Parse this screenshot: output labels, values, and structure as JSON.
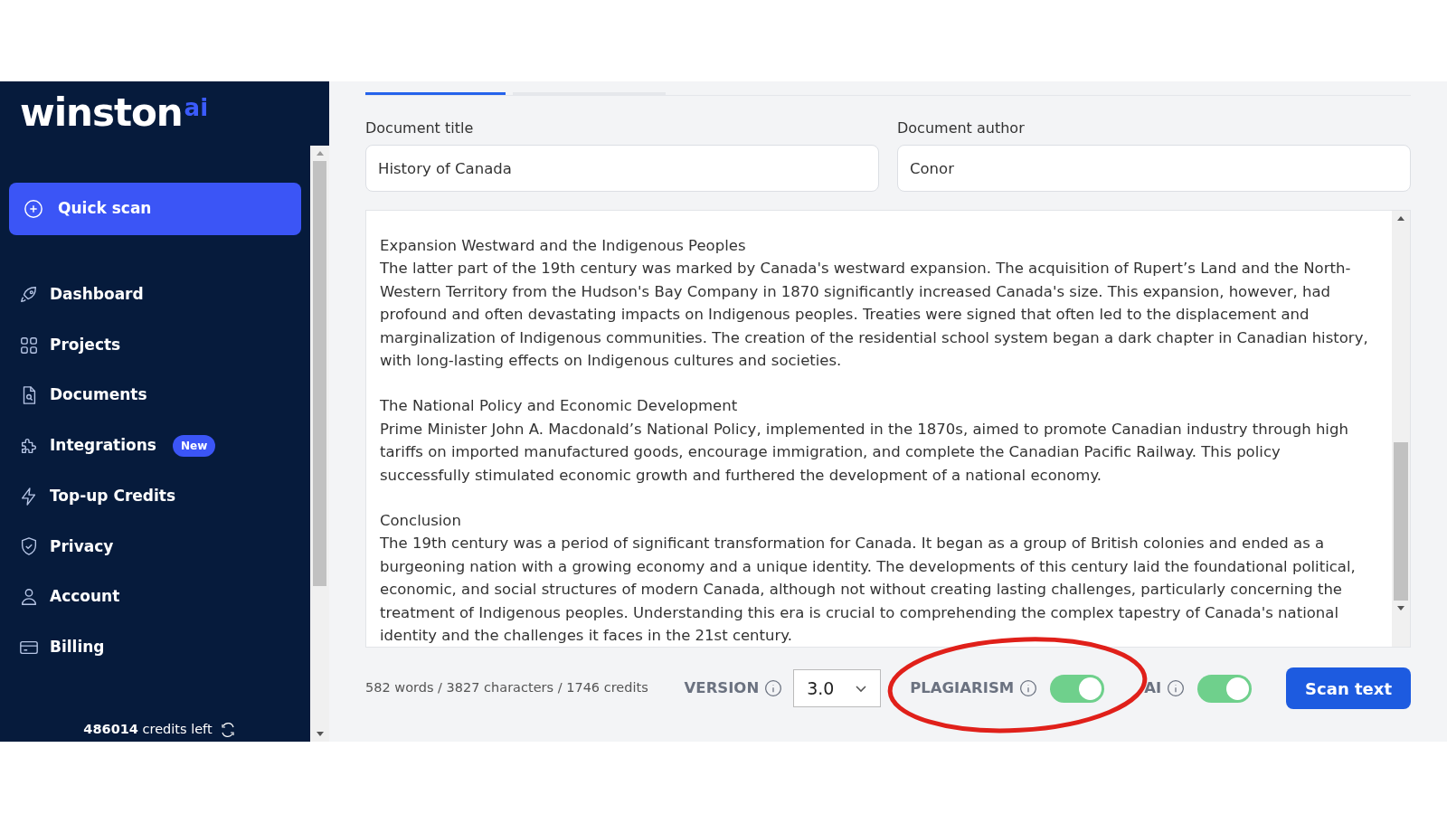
{
  "sidebar": {
    "logo": {
      "word": "winston",
      "suffix": "ai"
    },
    "quick_scan": "Quick scan",
    "items": [
      {
        "label": "Dashboard"
      },
      {
        "label": "Projects"
      },
      {
        "label": "Documents"
      },
      {
        "label": "Integrations",
        "badge": "New"
      },
      {
        "label": "Top-up Credits"
      },
      {
        "label": "Privacy"
      },
      {
        "label": "Account"
      },
      {
        "label": "Billing"
      }
    ],
    "credits": {
      "amount": "486014",
      "label": "credits left"
    }
  },
  "form": {
    "title_field": {
      "label": "Document title",
      "value": "History of Canada"
    },
    "author_field": {
      "label": "Document author",
      "value": "Conor"
    },
    "text_sections": [
      {
        "heading": "Expansion Westward and the Indigenous Peoples",
        "body": "The latter part of the 19th century was marked by Canada's westward expansion. The acquisition of Rupert’s Land and the North-Western Territory from the Hudson's Bay Company in 1870 significantly increased Canada's size. This expansion, however, had profound and often devastating impacts on Indigenous peoples. Treaties were signed that often led to the displacement and marginalization of Indigenous communities. The creation of the residential school system began a dark chapter in Canadian history, with long-lasting effects on Indigenous cultures and societies."
      },
      {
        "heading": "The National Policy and Economic Development",
        "body": "Prime Minister John A. Macdonald’s National Policy, implemented in the 1870s, aimed to promote Canadian industry through high tariffs on imported manufactured goods, encourage immigration, and complete the Canadian Pacific Railway. This policy successfully stimulated economic growth and furthered the development of a national economy."
      },
      {
        "heading": "Conclusion",
        "body": "The 19th century was a period of significant transformation for Canada. It began as a group of British colonies and ended as a burgeoning nation with a growing economy and a unique identity. The developments of this century laid the foundational political, economic, and social structures of modern Canada, although not without creating lasting challenges, particularly concerning the treatment of Indigenous peoples. Understanding this era is crucial to comprehending the complex tapestry of Canada's national identity and the challenges it faces in the 21st century."
      }
    ]
  },
  "footer": {
    "stats": "582 words / 3827 characters / 1746 credits",
    "version": {
      "label": "VERSION",
      "value": "3.0"
    },
    "toggles": [
      {
        "label": "PLAGIARISM",
        "on": true
      },
      {
        "label": "AI",
        "on": true
      }
    ],
    "scan_button": "Scan text"
  }
}
